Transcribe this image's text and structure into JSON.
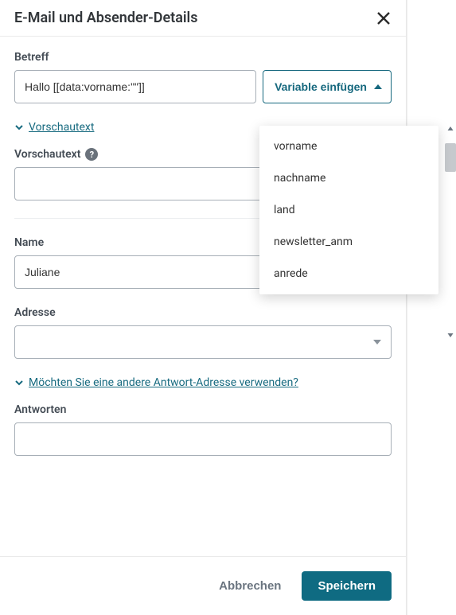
{
  "header": {
    "title": "E-Mail und Absender-Details"
  },
  "subject": {
    "label": "Betreff",
    "value": "Hallo [[data:vorname:\"\"]]",
    "insert_variable_label": "Variable einfügen"
  },
  "variable_dropdown": {
    "options": [
      "vorname",
      "nachname",
      "land",
      "newsletter_anm",
      "anrede"
    ]
  },
  "preview_toggle": {
    "label": "Vorschautext"
  },
  "preview_field": {
    "label": "Vorschautext",
    "help_glyph": "?",
    "value": ""
  },
  "name_field": {
    "label": "Name",
    "value": "Juliane"
  },
  "address_field": {
    "label": "Adresse",
    "value": ""
  },
  "reply_toggle": {
    "label": "Möchten Sie eine andere Antwort-Adresse verwenden?"
  },
  "reply_field": {
    "label": "Antworten",
    "value": ""
  },
  "footer": {
    "cancel": "Abbrechen",
    "save": "Speichern"
  }
}
